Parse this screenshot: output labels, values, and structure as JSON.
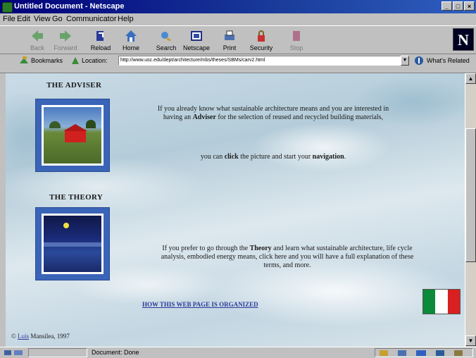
{
  "window": {
    "title": "Untitled Document - Netscape"
  },
  "menubar": {
    "items": [
      "File",
      "Edit",
      "View",
      "Go",
      "Communicator",
      "Help"
    ]
  },
  "toolbar": {
    "buttons": [
      {
        "label": "Back",
        "icon": "back-arrow-icon"
      },
      {
        "label": "Forward",
        "icon": "forward-arrow-icon"
      },
      {
        "label": "Reload",
        "icon": "reload-icon"
      },
      {
        "label": "Home",
        "icon": "home-icon"
      },
      {
        "label": "Search",
        "icon": "search-icon"
      },
      {
        "label": "Netscape",
        "icon": "netscape-icon"
      },
      {
        "label": "Print",
        "icon": "print-icon"
      },
      {
        "label": "Security",
        "icon": "security-icon"
      },
      {
        "label": "Stop",
        "icon": "stop-icon"
      }
    ],
    "logo": "N"
  },
  "locationbar": {
    "bookmarks_label": "Bookmarks",
    "location_label": "Location:",
    "url": "http://www.usc.edu/dept/architecture/mbs/theses/SBMs/carv2.html",
    "whats_related": "What's Related"
  },
  "page": {
    "adviser_heading": "THE ADVISER",
    "theory_heading": "THE THEORY",
    "adviser_text_1": "If you already know what sustainable architecture means and you are interested in having an ",
    "adviser_bold": "Adviser",
    "adviser_text_2": " for the selection of reused and recycled building materials,",
    "click_text_1": "you can ",
    "click_bold": "click",
    "click_text_2": " the picture and start your ",
    "navigation_bold": "navigation",
    "click_text_3": ".",
    "theory_text_1": "If you prefer to go through the ",
    "theory_bold": "Theory",
    "theory_text_2": " and learn what sustainable architecture, life cycle analysis, embodied energy means, click here and you will have a full explanation of these terms, and more.",
    "organized_link": "HOW THIS WEB PAGE IS ORGANIZED",
    "copyright_symbol": "©",
    "copyright_name": "Luis",
    "copyright_rest": " Mansilea, 1997",
    "flag_colors": [
      "#0a8a3a",
      "#ffffff",
      "#d82020"
    ]
  },
  "statusbar": {
    "text": "Document: Done"
  }
}
